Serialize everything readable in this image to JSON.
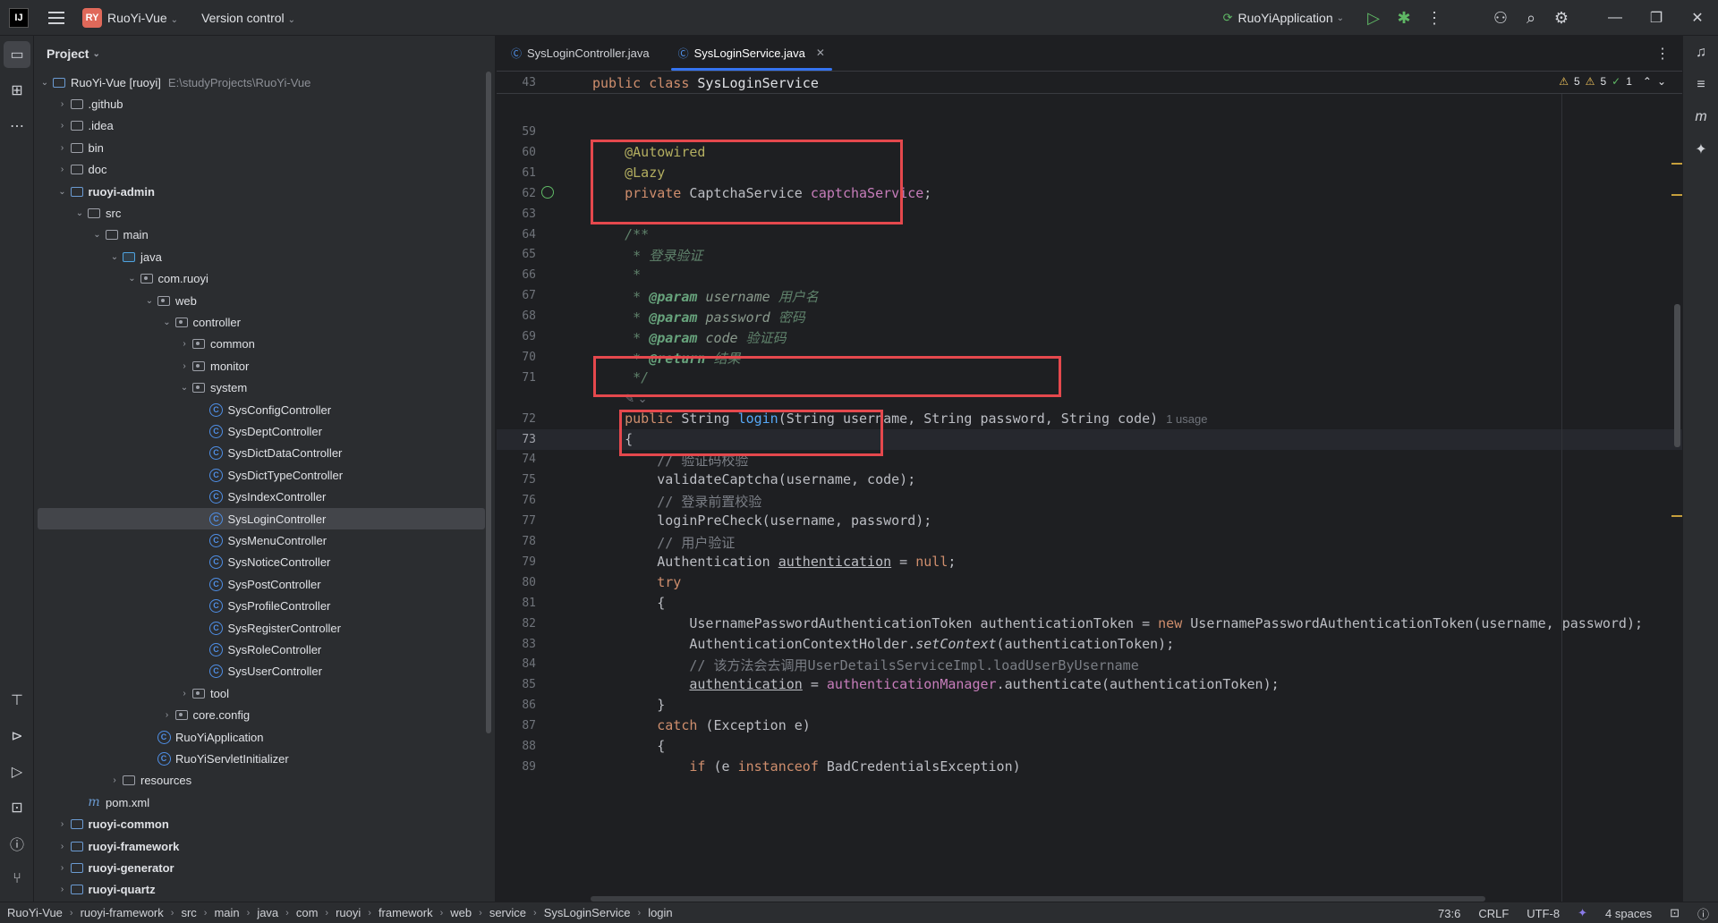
{
  "title_bar": {
    "project_badge": "RY",
    "project_name": "RuoYi-Vue",
    "version_control": "Version control",
    "run_config": "RuoYiApplication"
  },
  "project_panel": {
    "title": "Project",
    "root": {
      "name": "RuoYi-Vue [ruoyi]",
      "path": "E:\\studyProjects\\RuoYi-Vue"
    },
    "items": [
      {
        "label": ".github",
        "depth": 1,
        "arrow": "›",
        "icon": "folder"
      },
      {
        "label": ".idea",
        "depth": 1,
        "arrow": "›",
        "icon": "folder"
      },
      {
        "label": "bin",
        "depth": 1,
        "arrow": "›",
        "icon": "folder"
      },
      {
        "label": "doc",
        "depth": 1,
        "arrow": "›",
        "icon": "folder"
      },
      {
        "label": "ruoyi-admin",
        "depth": 1,
        "arrow": "⌄",
        "icon": "module",
        "bold": true
      },
      {
        "label": "src",
        "depth": 2,
        "arrow": "⌄",
        "icon": "folder"
      },
      {
        "label": "main",
        "depth": 3,
        "arrow": "⌄",
        "icon": "folder"
      },
      {
        "label": "java",
        "depth": 4,
        "arrow": "⌄",
        "icon": "src"
      },
      {
        "label": "com.ruoyi",
        "depth": 5,
        "arrow": "⌄",
        "icon": "pkg"
      },
      {
        "label": "web",
        "depth": 6,
        "arrow": "⌄",
        "icon": "pkg"
      },
      {
        "label": "controller",
        "depth": 7,
        "arrow": "⌄",
        "icon": "pkg"
      },
      {
        "label": "common",
        "depth": 8,
        "arrow": "›",
        "icon": "pkg"
      },
      {
        "label": "monitor",
        "depth": 8,
        "arrow": "›",
        "icon": "pkg"
      },
      {
        "label": "system",
        "depth": 8,
        "arrow": "⌄",
        "icon": "pkg"
      },
      {
        "label": "SysConfigController",
        "depth": 9,
        "arrow": "",
        "icon": "class"
      },
      {
        "label": "SysDeptController",
        "depth": 9,
        "arrow": "",
        "icon": "class"
      },
      {
        "label": "SysDictDataController",
        "depth": 9,
        "arrow": "",
        "icon": "class"
      },
      {
        "label": "SysDictTypeController",
        "depth": 9,
        "arrow": "",
        "icon": "class"
      },
      {
        "label": "SysIndexController",
        "depth": 9,
        "arrow": "",
        "icon": "class"
      },
      {
        "label": "SysLoginController",
        "depth": 9,
        "arrow": "",
        "icon": "class",
        "selected": true
      },
      {
        "label": "SysMenuController",
        "depth": 9,
        "arrow": "",
        "icon": "class"
      },
      {
        "label": "SysNoticeController",
        "depth": 9,
        "arrow": "",
        "icon": "class"
      },
      {
        "label": "SysPostController",
        "depth": 9,
        "arrow": "",
        "icon": "class"
      },
      {
        "label": "SysProfileController",
        "depth": 9,
        "arrow": "",
        "icon": "class"
      },
      {
        "label": "SysRegisterController",
        "depth": 9,
        "arrow": "",
        "icon": "class"
      },
      {
        "label": "SysRoleController",
        "depth": 9,
        "arrow": "",
        "icon": "class"
      },
      {
        "label": "SysUserController",
        "depth": 9,
        "arrow": "",
        "icon": "class"
      },
      {
        "label": "tool",
        "depth": 8,
        "arrow": "›",
        "icon": "pkg"
      },
      {
        "label": "core.config",
        "depth": 7,
        "arrow": "›",
        "icon": "pkg"
      },
      {
        "label": "RuoYiApplication",
        "depth": 6,
        "arrow": "",
        "icon": "class"
      },
      {
        "label": "RuoYiServletInitializer",
        "depth": 6,
        "arrow": "",
        "icon": "class"
      },
      {
        "label": "resources",
        "depth": 4,
        "arrow": "›",
        "icon": "folder"
      },
      {
        "label": "pom.xml",
        "depth": 2,
        "arrow": "",
        "icon": "maven"
      },
      {
        "label": "ruoyi-common",
        "depth": 1,
        "arrow": "›",
        "icon": "module",
        "bold": true
      },
      {
        "label": "ruoyi-framework",
        "depth": 1,
        "arrow": "›",
        "icon": "module",
        "bold": true
      },
      {
        "label": "ruoyi-generator",
        "depth": 1,
        "arrow": "›",
        "icon": "module",
        "bold": true
      },
      {
        "label": "ruoyi-quartz",
        "depth": 1,
        "arrow": "›",
        "icon": "module",
        "bold": true
      }
    ]
  },
  "editor": {
    "tabs": [
      {
        "label": "SysLoginController.java",
        "active": false
      },
      {
        "label": "SysLoginService.java",
        "active": true
      }
    ],
    "sticky": {
      "line": "43",
      "code": "public class SysLoginService"
    },
    "inspections": {
      "warn1": "5",
      "warn2": "5",
      "ok": "1"
    },
    "usage_hint": "1 usage",
    "lines": [
      {
        "n": "59",
        "html": ""
      },
      {
        "n": "60",
        "html": "    <span class='ann'>@Autowired</span>"
      },
      {
        "n": "61",
        "html": "    <span class='ann'>@Lazy</span>"
      },
      {
        "n": "62",
        "html": "    <span class='kw'>private</span> CaptchaService <span class='fld'>captchaService</span>;",
        "gutter": true
      },
      {
        "n": "63",
        "html": ""
      },
      {
        "n": "64",
        "html": "    <span class='doc'>/**</span>"
      },
      {
        "n": "65",
        "html": "     <span class='doc'>* 登录验证</span>"
      },
      {
        "n": "66",
        "html": "     <span class='doc'>*</span>"
      },
      {
        "n": "67",
        "html": "     <span class='doc'>* </span><span class='dtag'>@param</span><span class='doc'> </span><span class='doc' style='color:#8a9a8d'>username</span><span class='doc'> 用户名</span>"
      },
      {
        "n": "68",
        "html": "     <span class='doc'>* </span><span class='dtag'>@param</span><span class='doc'> </span><span class='doc' style='color:#8a9a8d'>password</span><span class='doc'> 密码</span>"
      },
      {
        "n": "69",
        "html": "     <span class='doc'>* </span><span class='dtag'>@param</span><span class='doc'> </span><span class='doc' style='color:#8a9a8d'>code</span><span class='doc'> 验证码</span>"
      },
      {
        "n": "70",
        "html": "     <span class='doc'>* </span><span class='dtag'>@return</span><span class='doc'> 结果</span>"
      },
      {
        "n": "71",
        "html": "     <span class='doc'>*/</span>"
      },
      {
        "n": "",
        "html": "    <span class='hint'>✎ ⌄</span>"
      },
      {
        "n": "72",
        "html": "    <span class='kw'>public</span> String <span class='fn'>login</span>(String username, String password, String code) <span class='hint'>1 usage</span>"
      },
      {
        "n": "73",
        "html": "    {",
        "current": true
      },
      {
        "n": "74",
        "html": "        <span class='cm'>// 验证码校验</span>"
      },
      {
        "n": "75",
        "html": "        validateCaptcha(username, code);"
      },
      {
        "n": "76",
        "html": "        <span class='cm'>// 登录前置校验</span>"
      },
      {
        "n": "77",
        "html": "        loginPreCheck(username, password);"
      },
      {
        "n": "78",
        "html": "        <span class='cm'>// 用户验证</span>"
      },
      {
        "n": "79",
        "html": "        Authentication <u>authentication</u> = <span class='kw'>null</span>;"
      },
      {
        "n": "80",
        "html": "        <span class='kw'>try</span>"
      },
      {
        "n": "81",
        "html": "        {"
      },
      {
        "n": "82",
        "html": "            UsernamePasswordAuthenticationToken authenticationToken = <span class='kw'>new</span> UsernamePasswordAuthenticationToken(username, password);"
      },
      {
        "n": "83",
        "html": "            AuthenticationContextHolder.<i>setContext</i>(authenticationToken);"
      },
      {
        "n": "84",
        "html": "            <span class='cm'>// 该方法会去调用UserDetailsServiceImpl.loadUserByUsername</span>"
      },
      {
        "n": "85",
        "html": "            <u>authentication</u> = <span class='fld'>authenticationManager</span>.authenticate(authenticationToken);"
      },
      {
        "n": "86",
        "html": "        }"
      },
      {
        "n": "87",
        "html": "        <span class='kw'>catch</span> (Exception e)"
      },
      {
        "n": "88",
        "html": "        {"
      },
      {
        "n": "89",
        "html": "            <span class='kw'>if</span> (e <span class='kw'>instanceof</span> BadCredentialsException)"
      }
    ]
  },
  "status_bar": {
    "breadcrumbs": [
      "RuoYi-Vue",
      "ruoyi-framework",
      "src",
      "main",
      "java",
      "com",
      "ruoyi",
      "framework",
      "web",
      "service",
      "SysLoginService",
      "login"
    ],
    "position": "73:6",
    "line_sep": "CRLF",
    "encoding": "UTF-8",
    "indent": "4 spaces"
  }
}
